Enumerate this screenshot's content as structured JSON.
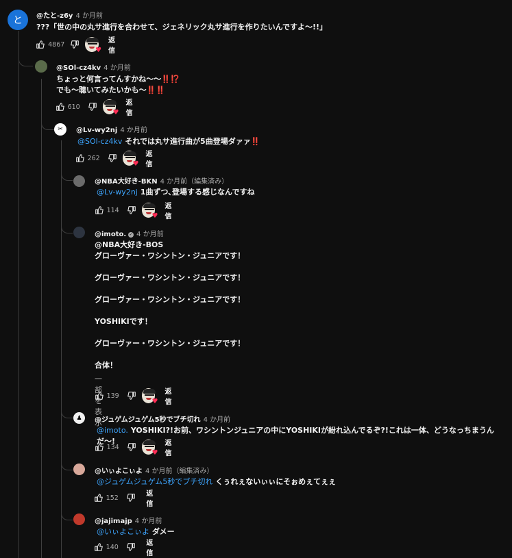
{
  "ui": {
    "reply_label": "返信",
    "show_more": "一部を表示"
  },
  "comments": [
    {
      "author": "@たと-z6y",
      "time": "4 か月前",
      "edited": "",
      "mention": "",
      "text": "???「世の中の丸サ進行を合わせて、ジェネリック丸サ進行を作りたいんですよ〜!!」",
      "likes": "4867",
      "avatar_letter": "と",
      "avatar_color": "#1a73d9",
      "hearted": true
    },
    {
      "author": "@SOl-cz4kv",
      "time": "4 か月前",
      "edited": "",
      "mention": "",
      "text": "ちょっと何言ってんすかね〜〜‼️⁉️\nでも〜聴いてみたいかも〜‼️‼️",
      "likes": "610",
      "avatar_letter": "",
      "avatar_color": "#5a6b4a",
      "hearted": true
    },
    {
      "author": "@Lv-wy2nj",
      "time": "4 か月前",
      "edited": "",
      "mention": "@SOl-cz4kv",
      "text": "それでは丸サ進行曲が5曲登場ダァァ‼️",
      "likes": "262",
      "avatar_letter": "",
      "avatar_color": "#ffffff",
      "hearted": true
    },
    {
      "author": "@NBA大好き-BKN",
      "time": "4 か月前",
      "edited": "（編集済み）",
      "mention": "@Lv-wy2nj",
      "text": "1曲ずつ､登場する感じなんですね",
      "likes": "114",
      "avatar_letter": "",
      "avatar_color": "#6b6b6b",
      "hearted": true
    },
    {
      "author": "@imoto.",
      "time": "4 か月前",
      "edited": "",
      "mention": "",
      "text": "@NBA大好き-BOS\nグローヴァー・ワシントン・ジュニアです！\n\nグローヴァー・ワシントン・ジュニアです！\n\nグローヴァー・ワシントン・ジュニアです！\n\nYOSHIKIです！\n\nグローヴァー・ワシントン・ジュニアです！\n\n合体！",
      "likes": "139",
      "avatar_letter": "",
      "avatar_color": "#2d3440",
      "hearted": true,
      "verified": true
    },
    {
      "author": "@ジュゲムジュゲム5秒でブチ切れ",
      "time": "4 か月前",
      "edited": "",
      "mention": "@imoto.",
      "text": "YOSHIKI?!お前、ワシントンジュニアの中にYOSHIKIが紛れ込んでるぞ?!これは一体、どうなっちまうんだ〜!",
      "likes": "134",
      "avatar_letter": "",
      "avatar_color": "#f1f1f1",
      "hearted": true
    },
    {
      "author": "@いぃよこぃよ",
      "time": "4 か月前",
      "edited": "（編集済み）",
      "mention": "@ジュゲムジュゲム5秒でブチ切れ",
      "text": "くぅれぇないぃぃにそぉめぇてぇぇ",
      "likes": "152",
      "avatar_letter": "",
      "avatar_color": "#d8a89a",
      "hearted": false
    },
    {
      "author": "@jajimajp",
      "time": "4 か月前",
      "edited": "",
      "mention": "@いぃよこぃよ",
      "text": "ダメー",
      "likes": "140",
      "avatar_letter": "",
      "avatar_color": "#c0392b",
      "hearted": false
    }
  ]
}
